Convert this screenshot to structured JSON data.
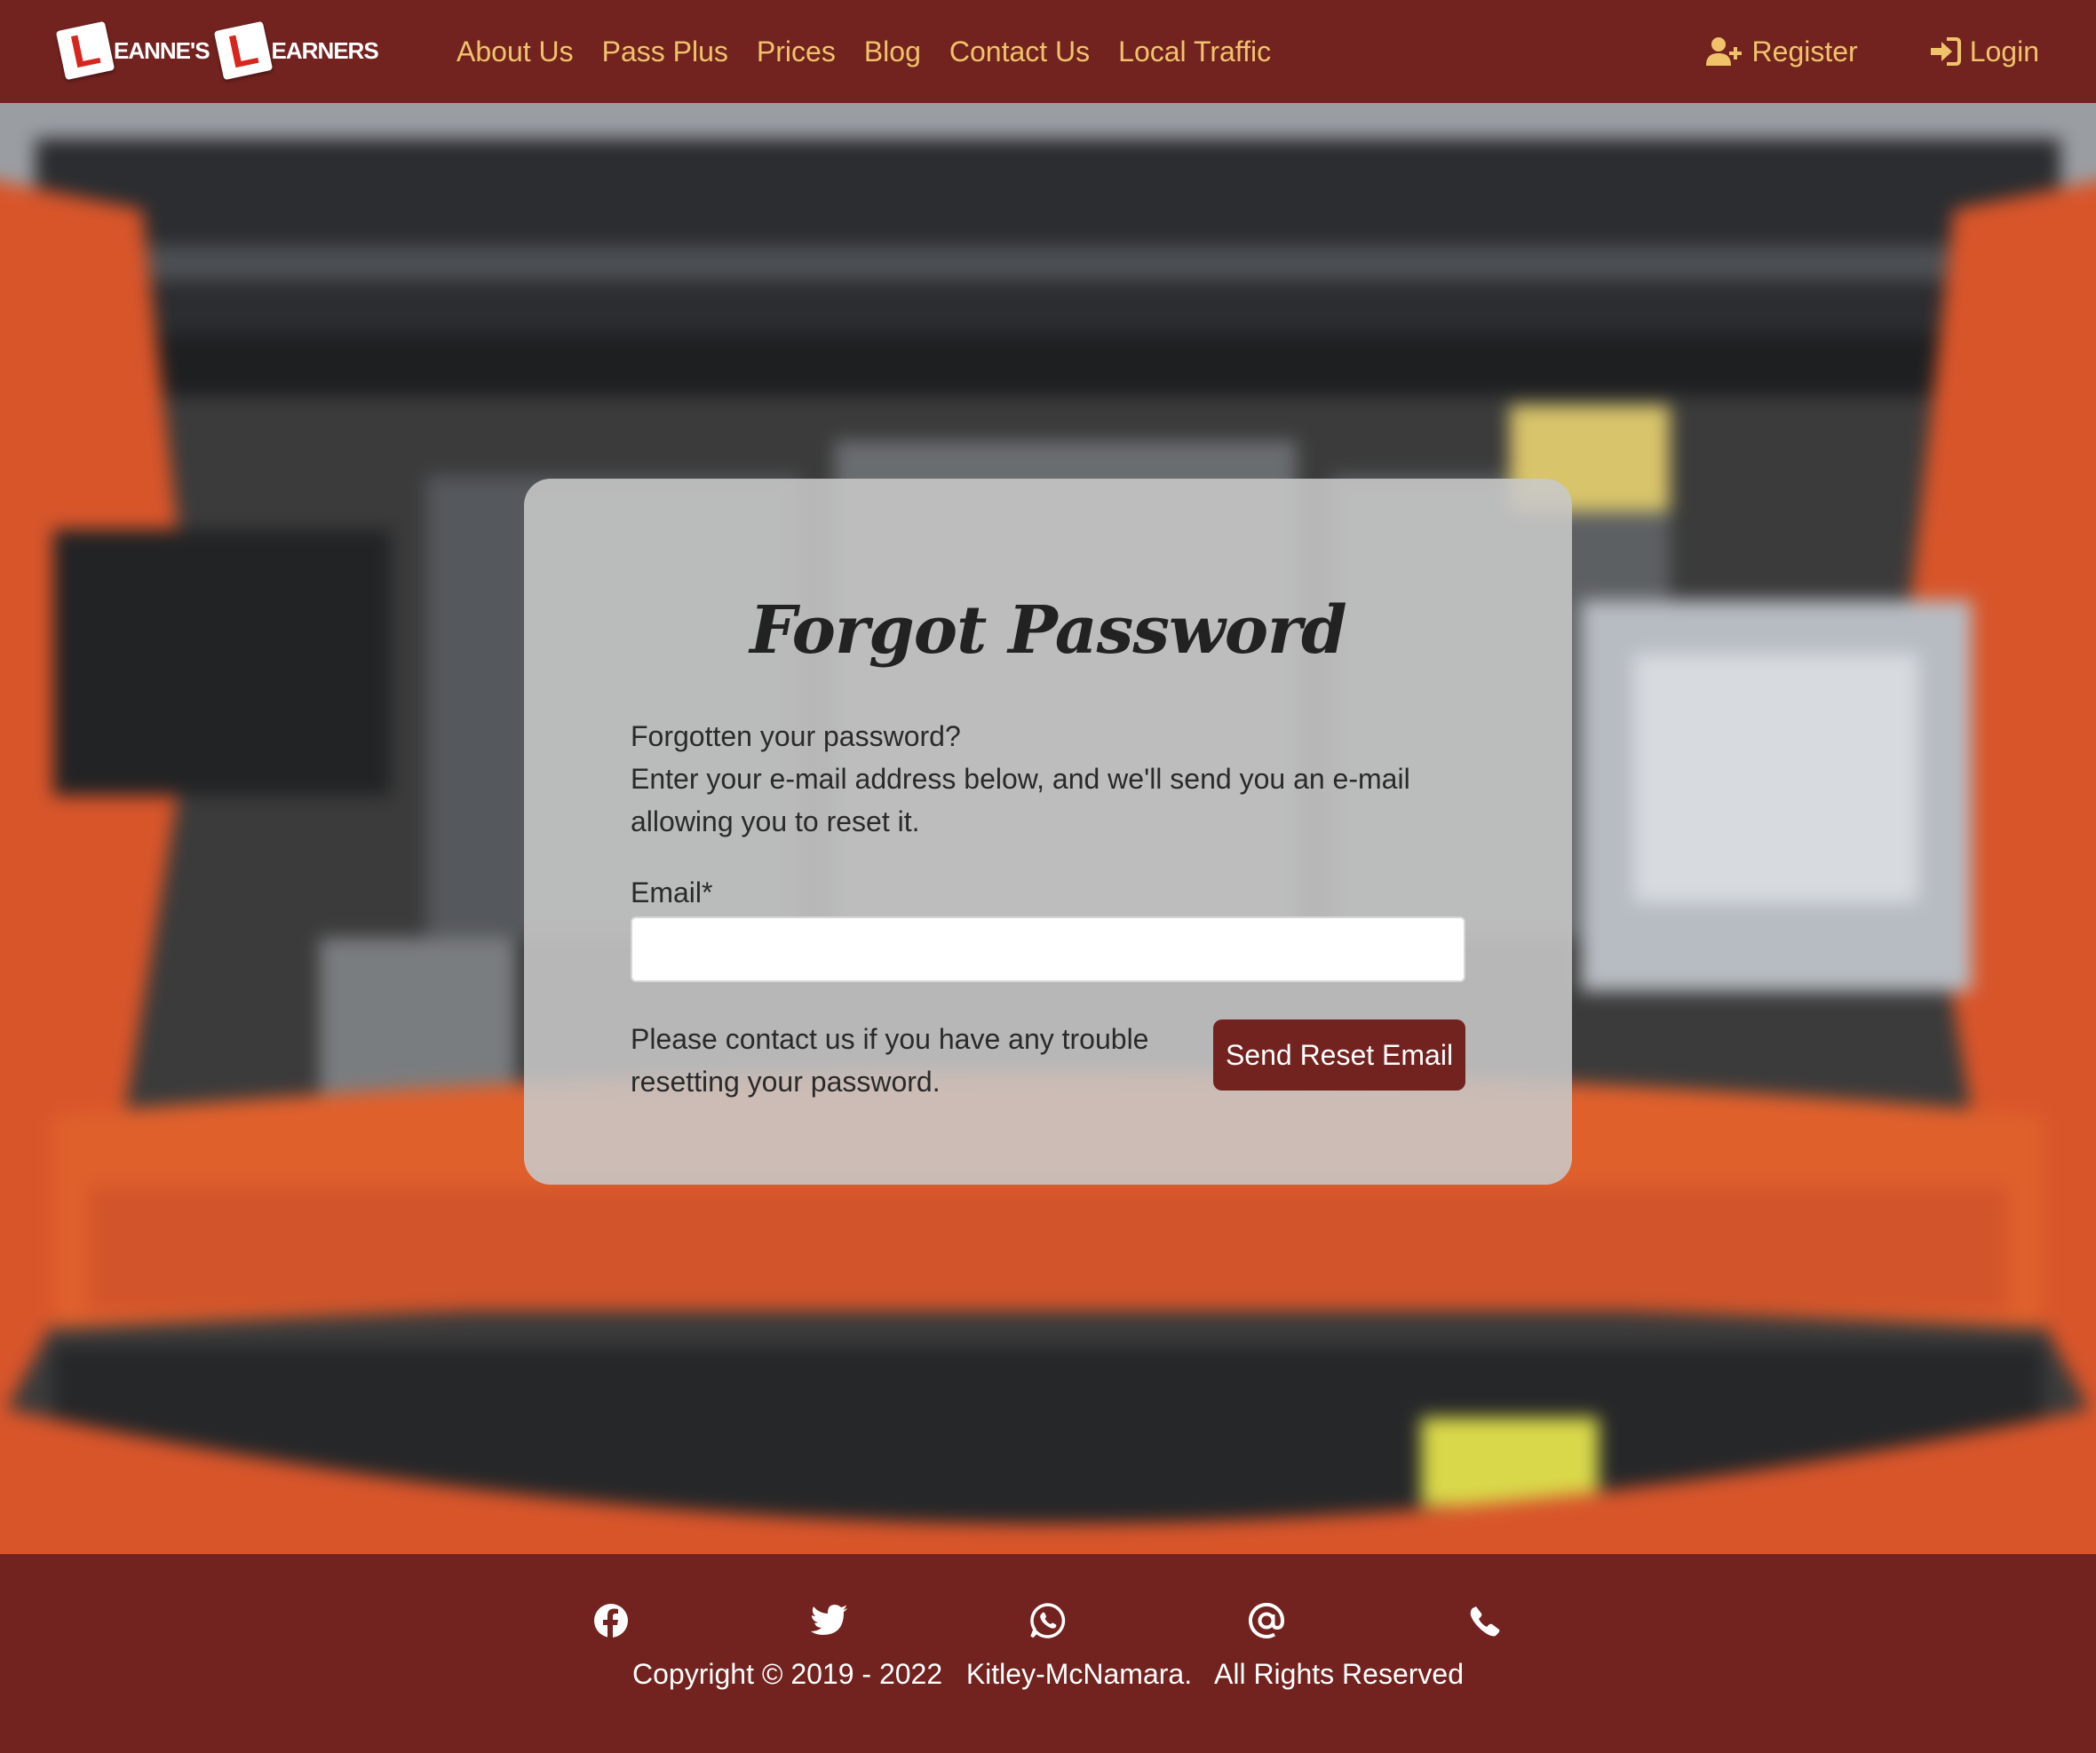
{
  "brand": {
    "plate_letter": "L",
    "word1": "EANNE'S",
    "word2": "EARNERS"
  },
  "nav": {
    "links": [
      "About Us",
      "Pass Plus",
      "Prices",
      "Blog",
      "Contact Us",
      "Local Traffic"
    ],
    "register_label": "Register",
    "login_label": "Login"
  },
  "form": {
    "title": "Forgot Password",
    "intro_line1": "Forgotten your password?",
    "intro_line2": "Enter your e-mail address below, and we'll send you an e-mail allowing you to reset it.",
    "email_label": "Email*",
    "email_value": "",
    "help_text": "Please contact us if you have any trouble resetting your password.",
    "submit_label": "Send Reset Email"
  },
  "footer": {
    "social_icons": [
      "facebook-icon",
      "twitter-icon",
      "whatsapp-icon",
      "at-sign-icon",
      "phone-icon"
    ],
    "copyright": "Copyright © 2019 - 2022   Kitley-McNamara.   All Rights Reserved"
  },
  "colors": {
    "brand_maroon": "#72231f",
    "nav_link_gold": "#f0c36b",
    "card_bg": "#c8c8c8"
  }
}
